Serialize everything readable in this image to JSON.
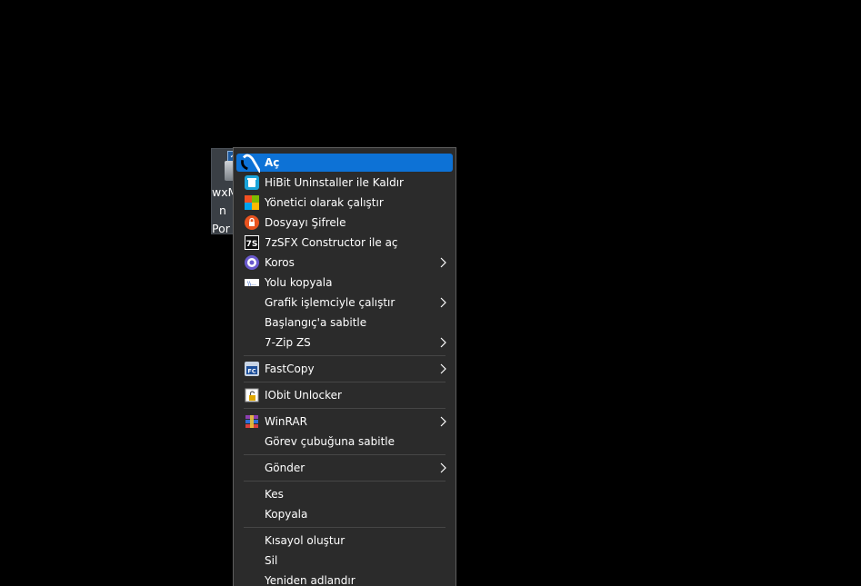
{
  "desktop_icon": {
    "label_lines": "wxM\n  n\nPor"
  },
  "menu": {
    "items": [
      {
        "label": "Aç",
        "icon": "open-app-icon",
        "submenu": false,
        "highlighted": true
      },
      {
        "label": "HiBit Uninstaller ile Kaldır",
        "icon": "hibit-trash-icon",
        "submenu": false
      },
      {
        "label": "Yönetici olarak çalıştır",
        "icon": "admin-shield-icon",
        "submenu": false
      },
      {
        "label": "Dosyayı Şifrele",
        "icon": "lock-icon",
        "submenu": false
      },
      {
        "label": "7zSFX Constructor ile aç",
        "icon": "7zsfx-icon",
        "submenu": false
      },
      {
        "label": "Koros",
        "icon": "koros-icon",
        "submenu": true
      },
      {
        "label": "Yolu kopyala",
        "icon": "copy-path-icon",
        "submenu": false
      },
      {
        "label": "Grafik işlemciyle çalıştır",
        "icon": "",
        "submenu": true
      },
      {
        "label": "Başlangıç'a sabitle",
        "icon": "",
        "submenu": false
      },
      {
        "label": "7-Zip ZS",
        "icon": "",
        "submenu": true
      },
      {
        "label": "FastCopy",
        "icon": "fastcopy-icon",
        "submenu": true
      },
      {
        "label": "IObit Unlocker",
        "icon": "iobit-unlocker-icon",
        "submenu": false
      },
      {
        "label": "WinRAR",
        "icon": "winrar-icon",
        "submenu": true
      },
      {
        "label": "Görev çubuğuna sabitle",
        "icon": "",
        "submenu": false
      },
      {
        "label": "Gönder",
        "icon": "",
        "submenu": true
      },
      {
        "label": "Kes",
        "icon": "",
        "submenu": false
      },
      {
        "label": "Kopyala",
        "icon": "",
        "submenu": false
      },
      {
        "label": "Kısayol oluştur",
        "icon": "",
        "submenu": false
      },
      {
        "label": "Sil",
        "icon": "",
        "submenu": false
      },
      {
        "label": "Yeniden adlandır",
        "icon": "",
        "submenu": false
      }
    ],
    "sevenzsfx_badge": "7S",
    "fastcopy_badge": "FC",
    "copy_path_badge": "\\\\..."
  },
  "colors": {
    "highlight": "#0d72d6",
    "menu_bg": "#2b2b2b",
    "separator": "#464646"
  }
}
